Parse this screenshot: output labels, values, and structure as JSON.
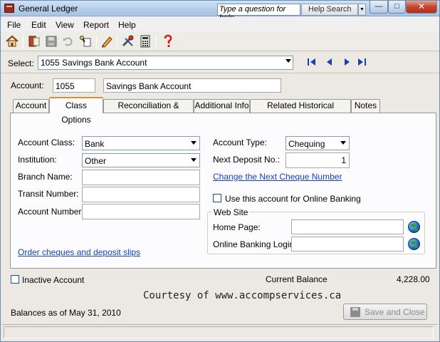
{
  "window": {
    "title": "General Ledger"
  },
  "help": {
    "question_text": "Type a question for help",
    "search_label": "Help Search"
  },
  "menu": [
    "File",
    "Edit",
    "View",
    "Report",
    "Help"
  ],
  "select": {
    "label": "Select:",
    "value": "1055 Savings Bank Account"
  },
  "account": {
    "label": "Account:",
    "number": "1055",
    "name": "Savings Bank Account"
  },
  "tabs": [
    {
      "label": "Account",
      "active": false
    },
    {
      "label": "Class Options",
      "active": true
    },
    {
      "label": "Reconciliation & Deposits",
      "active": false
    },
    {
      "label": "Additional Info",
      "active": false
    },
    {
      "label": "Related Historical Accounts",
      "active": false
    },
    {
      "label": "Notes",
      "active": false
    }
  ],
  "class_options": {
    "account_class_label": "Account Class:",
    "account_class_value": "Bank",
    "institution_label": "Institution:",
    "institution_value": "Other",
    "branch_name_label": "Branch Name:",
    "branch_name_value": "",
    "transit_number_label": "Transit Number:",
    "transit_number_value": "",
    "account_number_label": "Account Number:",
    "account_number_value": "",
    "order_link": "Order cheques and deposit slips",
    "account_type_label": "Account Type:",
    "account_type_value": "Chequing",
    "next_deposit_label": "Next Deposit No.:",
    "next_deposit_value": "1",
    "change_cheque_link": "Change the Next Cheque Number",
    "online_banking_label": "Use this account for Online Banking",
    "website_group_label": "Web Site",
    "home_page_label": "Home Page:",
    "home_page_value": "",
    "online_login_label": "Online Banking Login:",
    "online_login_value": ""
  },
  "footer": {
    "inactive_label": "Inactive Account",
    "current_balance_label": "Current Balance",
    "current_balance_value": "4,228.00",
    "courtesy_text": "Courtesy of www.accompservices.ca",
    "balances_as_of": "Balances as of May 31, 2010",
    "save_close_label": "Save and Close"
  }
}
